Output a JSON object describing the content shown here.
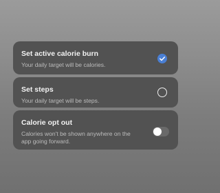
{
  "colors": {
    "card_bg": "#525252",
    "accent": "#4a7fd4",
    "title_text": "#f2f2f2",
    "desc_text": "#bdbdbd"
  },
  "options": [
    {
      "title": "Set active calorie burn",
      "description": "Your daily target will be calories.",
      "control": "radio",
      "selected": true,
      "icon": "checkmark-circle-icon"
    },
    {
      "title": "Set steps",
      "description": "Your daily target will be steps.",
      "control": "radio",
      "selected": false,
      "icon": "radio-empty-icon"
    },
    {
      "title": "Calorie opt out",
      "description": "Calories won't be shown anywhere on the app going forward.",
      "control": "toggle",
      "on": false,
      "icon": "toggle-icon"
    }
  ]
}
